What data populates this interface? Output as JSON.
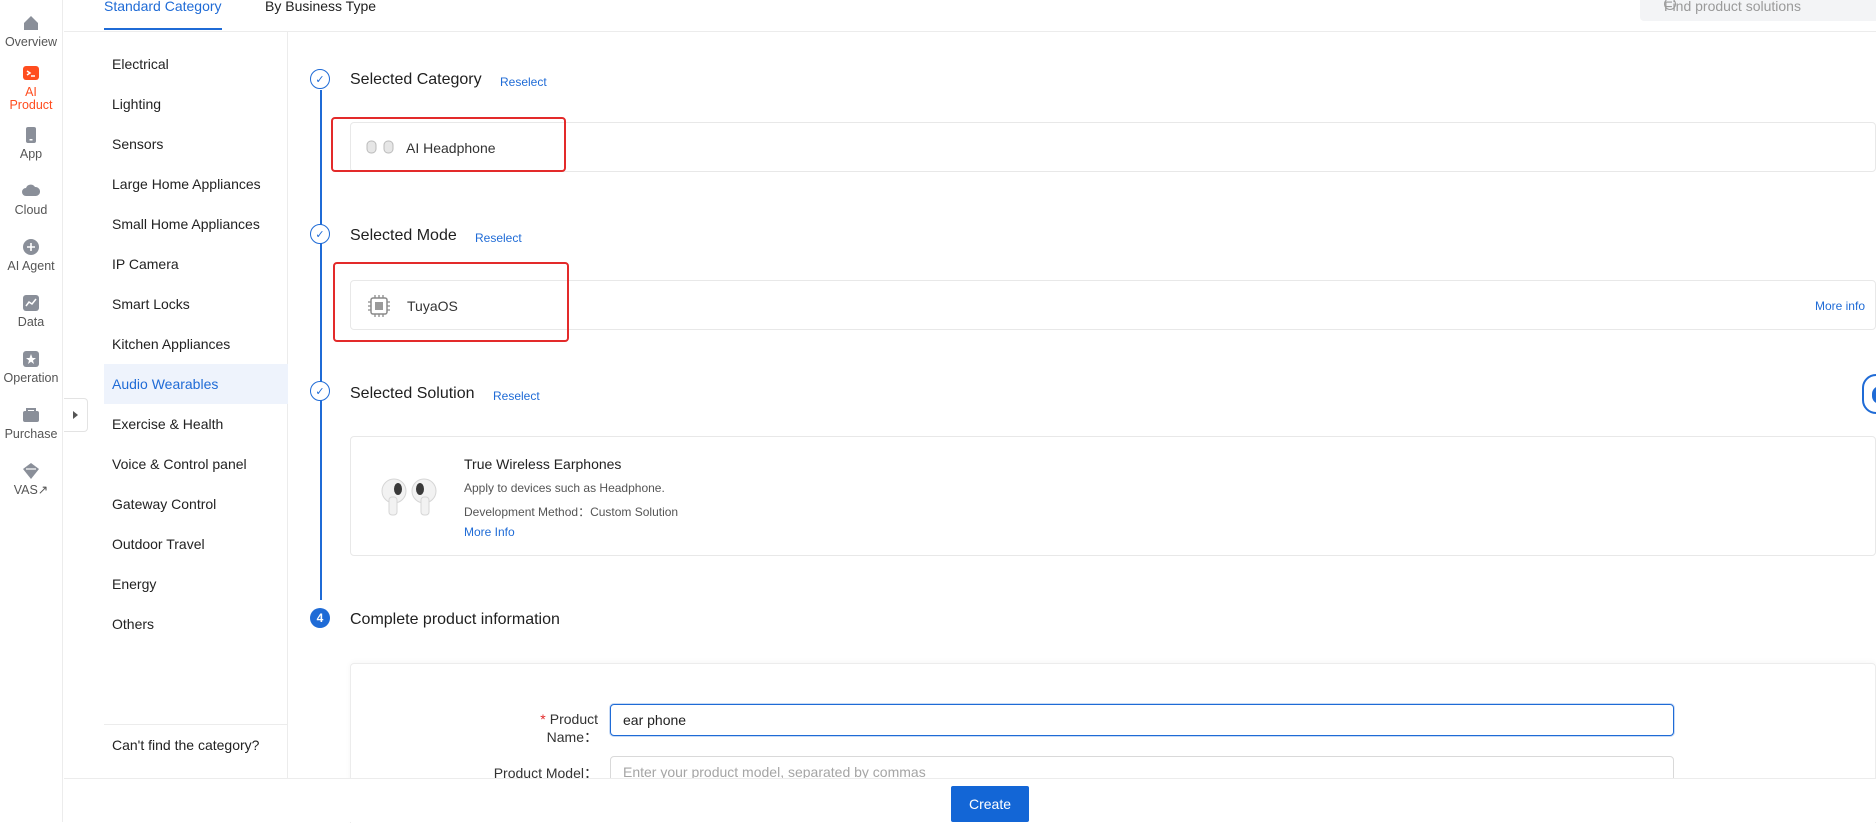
{
  "rail": {
    "items": [
      {
        "label": "Overview",
        "icon": "home-icon"
      },
      {
        "label": "AI Product",
        "icon": "terminal-icon",
        "active": true
      },
      {
        "label": "App",
        "icon": "phone-icon"
      },
      {
        "label": "Cloud",
        "icon": "cloud-icon"
      },
      {
        "label": "AI Agent",
        "icon": "plus-circle-icon"
      },
      {
        "label": "Data",
        "icon": "chart-icon"
      },
      {
        "label": "Operation",
        "icon": "star-box-icon"
      },
      {
        "label": "Purchase",
        "icon": "cart-icon"
      },
      {
        "label": "VAS↗",
        "icon": "diamond-icon"
      }
    ]
  },
  "tabs": {
    "standard": "Standard Category",
    "business": "By Business Type"
  },
  "search": {
    "placeholder": "Find product solutions"
  },
  "categories": [
    "Electrical",
    "Lighting",
    "Sensors",
    "Large Home Appliances",
    "Small Home Appliances",
    "IP Camera",
    "Smart Locks",
    "Kitchen Appliances",
    "Audio Wearables",
    "Exercise & Health",
    "Voice & Control panel",
    "Gateway Control",
    "Outdoor Travel",
    "Energy",
    "Others"
  ],
  "active_category": "Audio Wearables",
  "cats_footer": "Can't find the category?",
  "steps": {
    "category": {
      "title": "Selected Category",
      "reselect": "Reselect",
      "value": "AI Headphone"
    },
    "mode": {
      "title": "Selected Mode",
      "reselect": "Reselect",
      "value": "TuyaOS",
      "more": "More info"
    },
    "solution": {
      "title": "Selected Solution",
      "reselect": "Reselect",
      "name": "True Wireless Earphones",
      "desc": "Apply to devices such as Headphone.",
      "method": "Development Method：Custom Solution",
      "more": "More Info"
    },
    "info": {
      "number": "4",
      "title": "Complete product information"
    }
  },
  "form": {
    "name_label": "Product Name：",
    "name_value": "ear phone",
    "model_label": "Product Model：",
    "model_placeholder": "Enter your product model, separated by commas"
  },
  "create_label": "Create",
  "colors": {
    "accent": "#1f6bd6",
    "brand": "#ff4d1f",
    "highlight": "#e32a2a"
  }
}
